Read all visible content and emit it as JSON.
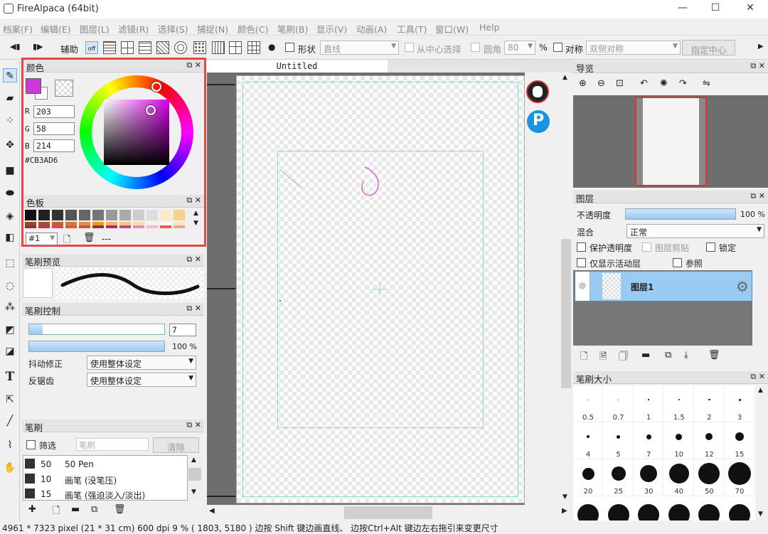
{
  "app": {
    "title": "FireAlpaca (64bit)",
    "minimize": "—",
    "maximize": "☐",
    "close": "✕"
  },
  "menu": [
    "档案(F)",
    "编辑(E)",
    "图层(L)",
    "滤镜(R)",
    "选择(S)",
    "捕捉(N)",
    "颜色(C)",
    "笔刷(B)",
    "显示(V)",
    "动画(A)",
    "工具(T)",
    "窗口(W)",
    "Help"
  ],
  "toolbar": {
    "assist": "辅助",
    "off": "off",
    "shape_label": "形状",
    "shape_value": "直线",
    "from_center": "从中心选择",
    "round_label": "圆角",
    "round_value": "80",
    "percent": "%",
    "symmetry_label": "对称",
    "symmetry_value": "双侧对称",
    "center_button": "指定中心"
  },
  "color_panel": {
    "title": "颜色",
    "r_label": "R",
    "r": "203",
    "g_label": "G",
    "g": "58",
    "b_label": "B",
    "b": "214",
    "hex": "#CB3AD6",
    "fg": "#CB3AD6"
  },
  "palette_panel": {
    "title": "色板",
    "number": "#1",
    "dashes": "---",
    "row1": [
      "#111111",
      "#222222",
      "#333333",
      "#555555",
      "#666666",
      "#777777",
      "#999999",
      "#aaaaaa",
      "#cccccc",
      "#dddddd",
      "#fde9c9",
      "#f8d08a"
    ],
    "row2": [
      "#8b4a2b",
      "#a0522d",
      "#c0622f",
      "#cf7a3e",
      "#e08d51",
      "#f39c12",
      "#f7b26a",
      "#f8c48a",
      "#fcd9b0",
      "#fff1e0",
      "#ffffff",
      "#fde2cf"
    ],
    "row3": [
      "#a0283a",
      "#c0334b",
      "#e2445d",
      "#e55b2d",
      "#d0573a",
      "#9c2c4a",
      "#b02c6f",
      "#d93a8a",
      "#e28fb4",
      "#f5b9cf",
      "#e0604a",
      "#f4a289"
    ]
  },
  "brush_preview": {
    "title": "笔刷预览"
  },
  "brush_control": {
    "title": "笔刷控制",
    "size": "7",
    "opacity_text": "100 %",
    "opacity": 1.0,
    "size_fill": 0.1,
    "stabilizer_label": "抖动修正",
    "stabilizer_value": "使用整体设定",
    "antialias_label": "反锯齿",
    "antialias_value": "使用整体设定"
  },
  "brush_panel": {
    "title": "笔刷",
    "filter_label": "筛选",
    "search_placeholder": "笔刷",
    "clear": "清除",
    "items": [
      {
        "size": "50",
        "name": "50 Pen"
      },
      {
        "size": "10",
        "name": "画笔 (没笔压)"
      },
      {
        "size": "15",
        "name": "画笔 (强迫淡入/淡出)"
      }
    ]
  },
  "document": {
    "tab": "Untitled"
  },
  "navigator": {
    "title": "导览"
  },
  "layers": {
    "title": "图层",
    "opacity_label": "不透明度",
    "opacity_text": "100 %",
    "opacity": 1.0,
    "blend_label": "混合",
    "blend_value": "正常",
    "protect_alpha": "保护透明度",
    "clipping": "图层剪贴",
    "lock": "锁定",
    "show_active": "仅显示活动层",
    "reference": "参照",
    "layer_name": "图层1"
  },
  "brush_size": {
    "title": "笔刷大小",
    "sizes": [
      "0.5",
      "0.7",
      "1",
      "1.5",
      "2",
      "3",
      "4",
      "5",
      "7",
      "10",
      "12",
      "15",
      "20",
      "25",
      "30",
      "40",
      "50",
      "70"
    ]
  },
  "status": "4961 * 7323 pixel   (21 * 31 cm)   600 dpi   9 %   ( 1803, 5180 )  边按 Shift 键边画直线、 边按Ctrl+Alt 键边左右拖引来变更尺寸",
  "colors": {
    "accent": "#3aa6e0",
    "highlight": "#e03030",
    "selection": "#99ccf0"
  }
}
